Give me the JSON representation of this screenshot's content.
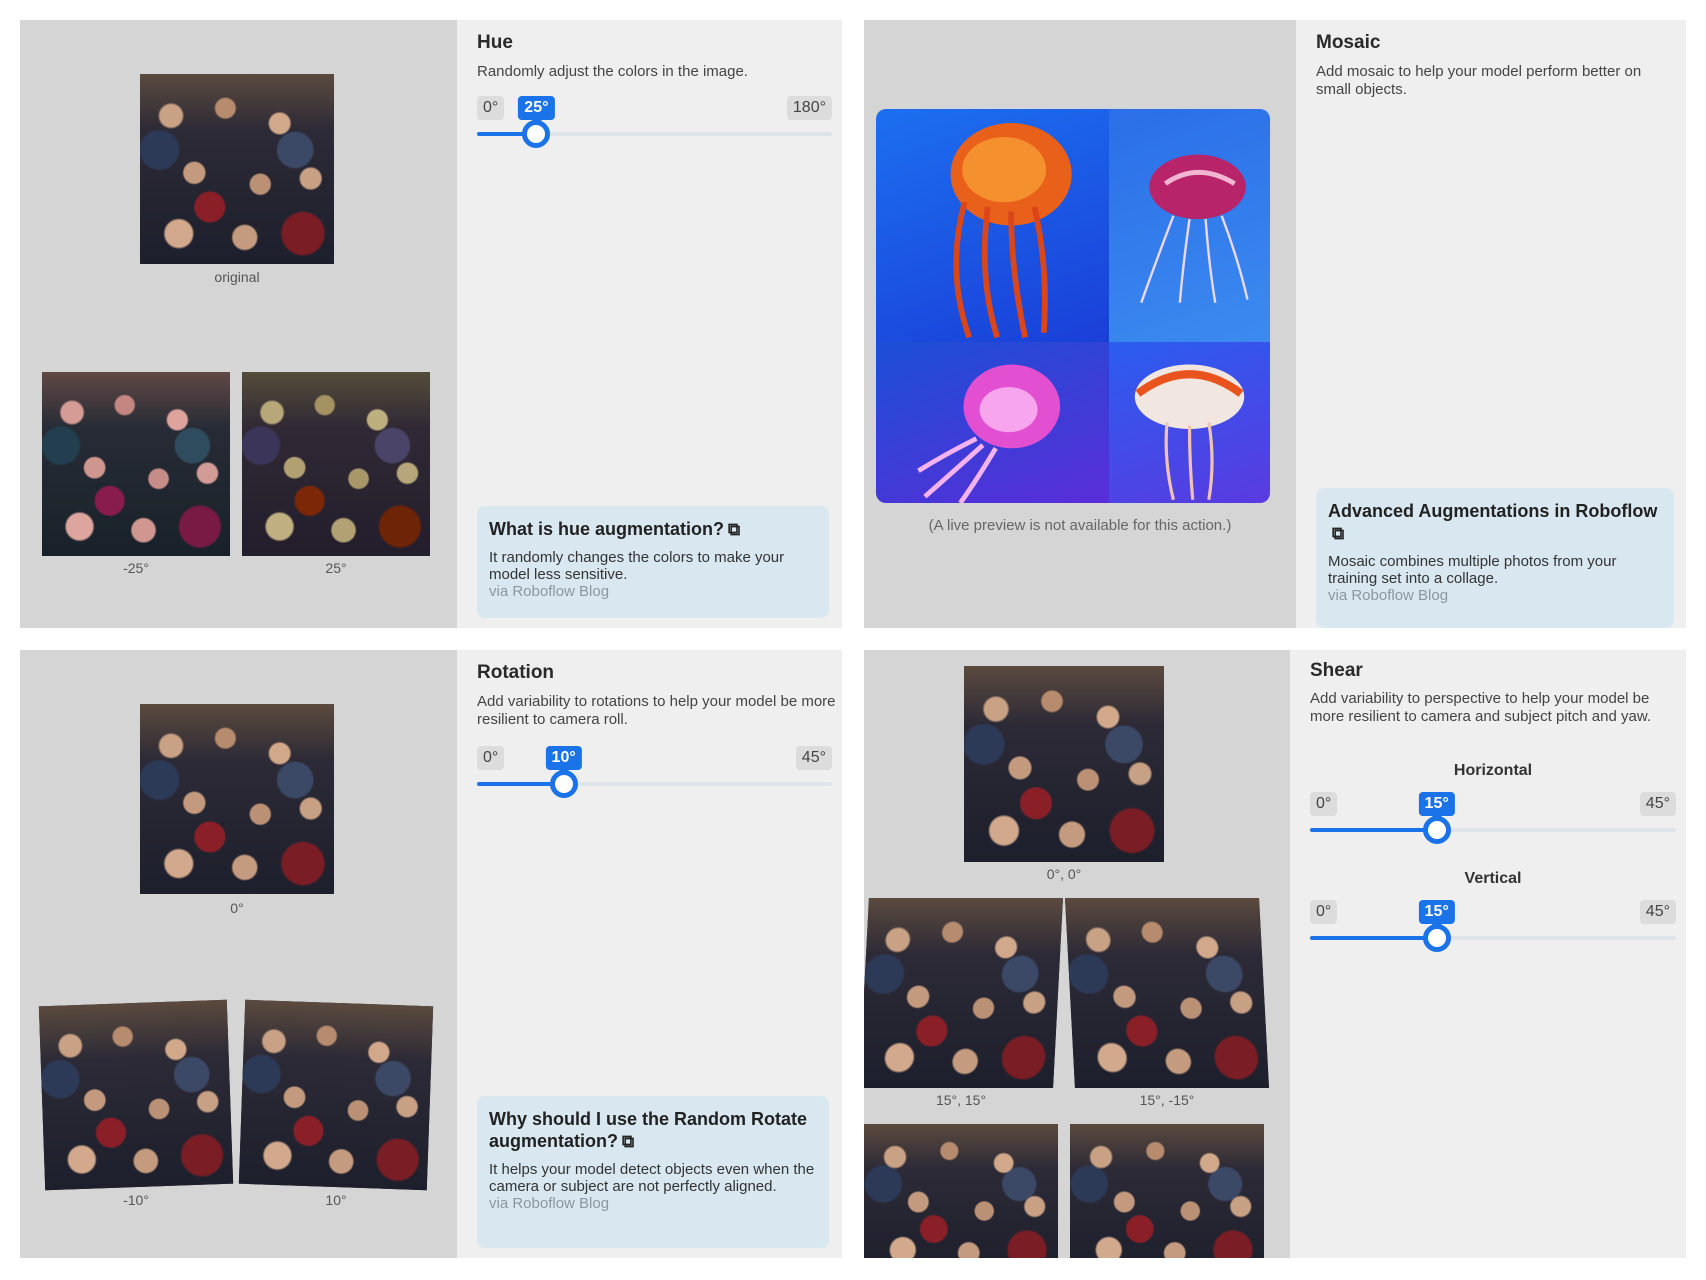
{
  "hue": {
    "title": "Hue",
    "description": "Randomly adjust the colors in the image.",
    "original_label": "original",
    "sample_labels": [
      "-25°",
      "25°"
    ],
    "slider": {
      "min_label": "0°",
      "max_label": "180°",
      "value_label": "25°",
      "value": 25,
      "max": 180
    },
    "card": {
      "title": "What is hue augmentation?",
      "text": "It randomly changes the colors to make your model less sensitive.",
      "source": "via Roboflow Blog"
    }
  },
  "mosaic": {
    "title": "Mosaic",
    "description": "Add mosaic to help your model perform better on small objects.",
    "note": "(A live preview is not available for this action.)",
    "card": {
      "title": "Advanced Augmentations in Roboflow",
      "text": "Mosaic combines multiple photos from your training set into a collage.",
      "source": "via Roboflow Blog"
    }
  },
  "rotation": {
    "title": "Rotation",
    "description": "Add variability to rotations to help your model be more resilient to camera roll.",
    "original_label": "0°",
    "sample_labels": [
      "-10°",
      "10°"
    ],
    "slider": {
      "min_label": "0°",
      "max_label": "45°",
      "value_label": "10°",
      "value": 10,
      "max": 45
    },
    "card": {
      "title": "Why should I use the Random Rotate augmentation?",
      "text": "It helps your model detect objects even when the camera or subject are not perfectly aligned.",
      "source": "via Roboflow Blog"
    }
  },
  "shear": {
    "title": "Shear",
    "description": "Add variability to perspective to help your model be more resilient to camera and subject pitch and yaw.",
    "original_label": "0°, 0°",
    "sample_labels": [
      "15°, 15°",
      "15°, -15°"
    ],
    "horizontal": {
      "label": "Horizontal",
      "slider": {
        "min_label": "0°",
        "max_label": "45°",
        "value_label": "15°",
        "value": 15,
        "max": 45
      }
    },
    "vertical": {
      "label": "Vertical",
      "slider": {
        "min_label": "0°",
        "max_label": "45°",
        "value_label": "15°",
        "value": 15,
        "max": 45
      }
    }
  },
  "icons": {
    "external_link": "external-link-icon"
  },
  "colors": {
    "accent": "#1a73e8",
    "card_bg": "#d9e8f0",
    "preview_bg": "#d5d5d5",
    "panel_bg": "#efefef"
  }
}
